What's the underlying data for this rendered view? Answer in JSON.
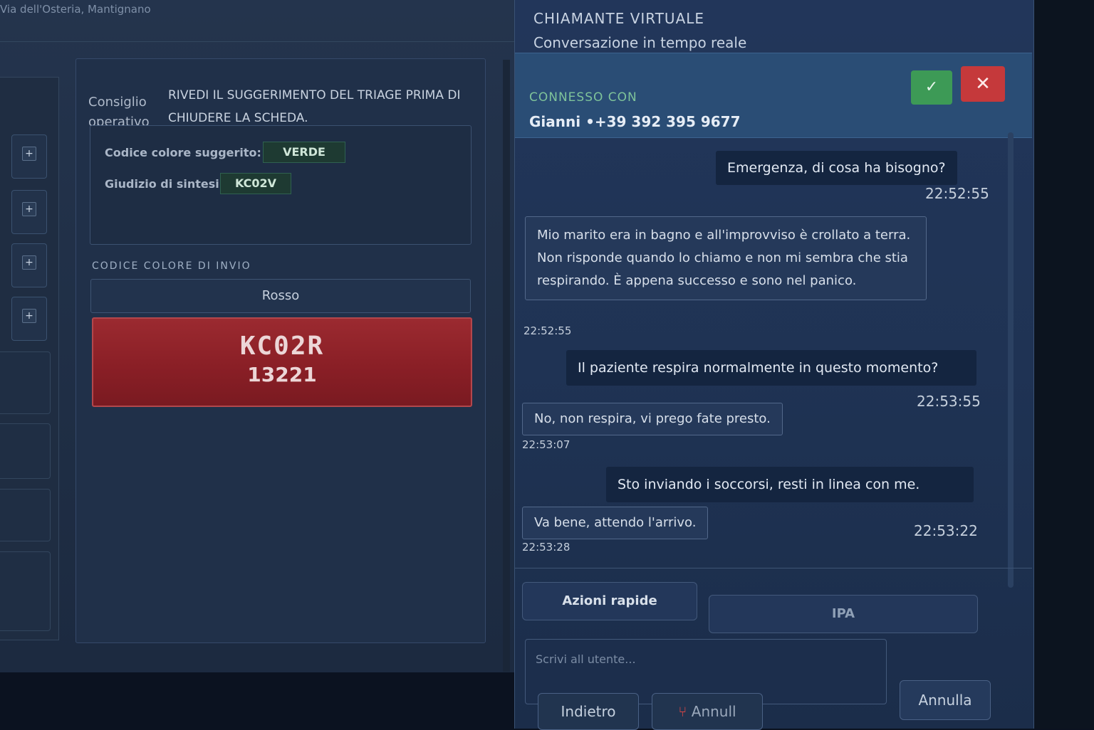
{
  "left": {
    "address": "Via dell'Osteria, Mantignano",
    "advice_label": "Consiglio operativo",
    "advice_text": "RIVEDI IL SUGGERIMENTO DEL TRIAGE PRIMA DI CHIUDERE LA SCHEDA.",
    "suggested_color_label": "Codice colore suggerito:",
    "suggested_color_value": "VERDE",
    "summary_label": "Giudizio di sintesi:",
    "summary_value": "KC02V",
    "send_color_label": "CODICE COLORE DI INVIO",
    "send_color_value": "Rosso",
    "dispatch_code": "KC02R",
    "dispatch_number": "13221",
    "side_buttons": [
      "+",
      "+",
      "+",
      "+"
    ]
  },
  "chat": {
    "title": "CHIAMANTE VIRTUALE",
    "subtitle": "Conversazione in tempo reale",
    "connected_label": "CONNESSO CON",
    "caller": "Gianni •+39 392 395 9677",
    "accept_icon": "✓",
    "reject_icon": "✕",
    "messages": [
      {
        "from": "operator",
        "text": "Emergenza, di cosa ha bisogno?",
        "time": "22:52:55"
      },
      {
        "from": "caller",
        "text": "Mio marito era in bagno e all'improvviso è crollato a terra. Non risponde quando lo chiamo e non mi sembra che stia respirando. È appena successo e sono nel panico.",
        "time": "22:52:55"
      },
      {
        "from": "operator",
        "text": "Il paziente respira normalmente in questo momento?",
        "time": "22:53:55"
      },
      {
        "from": "caller",
        "text": "No, non respira, vi prego fate presto.",
        "time": "22:53:07"
      },
      {
        "from": "operator",
        "text": "Sto inviando i soccorsi, resti in linea con me.",
        "time": "22:53:22"
      },
      {
        "from": "caller",
        "text": "Va bene, attendo l'arrivo.",
        "time": "22:53:28"
      }
    ],
    "quick_actions_label": "Azioni rapide",
    "ipa_label": "IPA",
    "input_placeholder": "Scrivi all utente...",
    "cancel_label": "Annulla",
    "back_label": "Indietro",
    "annul_label": "Annull"
  },
  "colors": {
    "accept": "#3d9a56",
    "reject": "#c5393b",
    "dispatch_red": "#8a1f26",
    "suggest_green": "#1e3a32",
    "connected_green": "#7fc39a"
  }
}
